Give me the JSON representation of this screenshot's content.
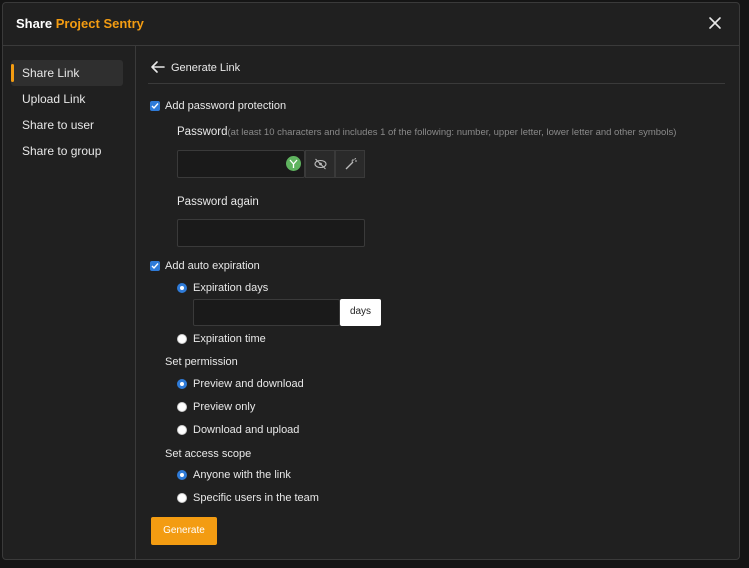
{
  "dialog": {
    "title_prefix": "Share",
    "title_project": "Project Sentry"
  },
  "sidebar": {
    "items": [
      {
        "label": "Share Link",
        "active": true
      },
      {
        "label": "Upload Link"
      },
      {
        "label": "Share to user"
      },
      {
        "label": "Share to group"
      }
    ]
  },
  "main": {
    "back_label": "Generate Link",
    "password_protection": {
      "label": "Add password protection",
      "checked": true
    },
    "password": {
      "label": "Password",
      "hint": "(at least 10 characters and includes 1 of the following: number, upper letter, lower letter and other symbols)",
      "value": ""
    },
    "password_again": {
      "label": "Password again",
      "value": ""
    },
    "auto_expiration": {
      "label": "Add auto expiration",
      "checked": true
    },
    "expiration": {
      "days_label": "Expiration days",
      "days_value": "",
      "days_unit": "days",
      "time_label": "Expiration time",
      "selected": "days"
    },
    "permission": {
      "label": "Set permission",
      "options": [
        "Preview and download",
        "Preview only",
        "Download and upload"
      ],
      "selected": "Preview and download"
    },
    "access_scope": {
      "label": "Set access scope",
      "options": [
        "Anyone with the link",
        "Specific users in the team"
      ],
      "selected": "Anyone with the link"
    },
    "generate_label": "Generate"
  },
  "colors": {
    "accent": "#f39c12",
    "checkbox": "#2f7bd8",
    "background": "#202020"
  }
}
